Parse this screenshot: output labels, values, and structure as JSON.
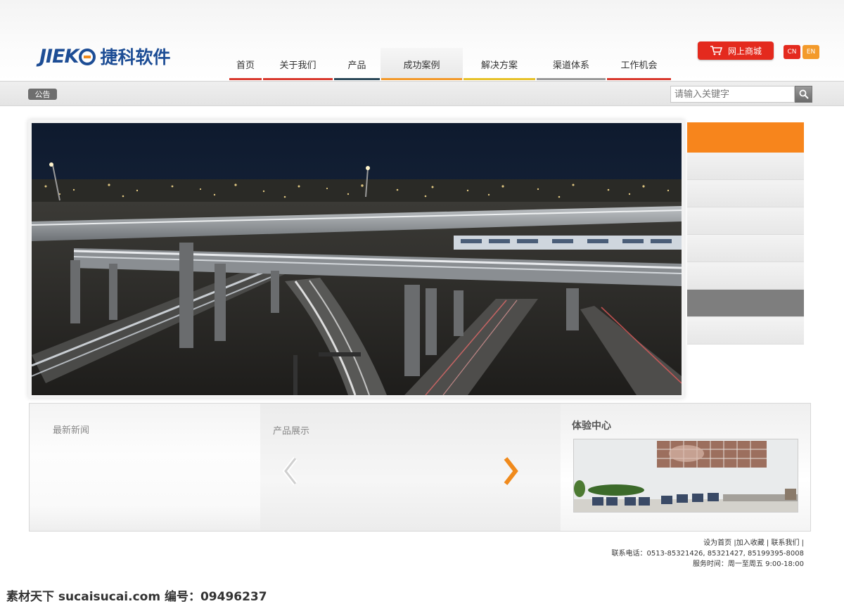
{
  "header": {
    "logo_en": "JIEK",
    "logo_cn": "捷科软件",
    "nav": [
      {
        "label": "首页",
        "color": "#d93a2f"
      },
      {
        "label": "关于我们",
        "color": "#d93a2f"
      },
      {
        "label": "产品",
        "color": "#2d4a5a"
      },
      {
        "label": "成功案例",
        "color": "#f39a2b"
      },
      {
        "label": "解决方案",
        "color": "#e7c22b"
      },
      {
        "label": "渠道体系",
        "color": "#9a9a9a"
      },
      {
        "label": "工作机会",
        "color": "#d93a2f"
      }
    ],
    "active_index": 3,
    "shop_label": "网上商城",
    "lang_cn": "CN",
    "lang_en": "EN"
  },
  "notice": {
    "tag": "公告",
    "search_placeholder": "请输入关键字"
  },
  "sections": {
    "news_title": "最新新闻",
    "products_title": "产品展示",
    "experience_title": "体验中心"
  },
  "footer": {
    "links": "设为首页 |加入收藏 | 联系我们 |",
    "phone": "联系电话：0513-85321426, 85321427, 85199395-8008",
    "hours": "服务时间：周一至周五 9:00-18:00"
  },
  "watermark": "素材天下 sucaisucai.com   编号：09496237",
  "colors": {
    "accent_orange": "#f7851c",
    "brand_blue": "#1d4d95",
    "shop_red": "#e42a1e"
  }
}
